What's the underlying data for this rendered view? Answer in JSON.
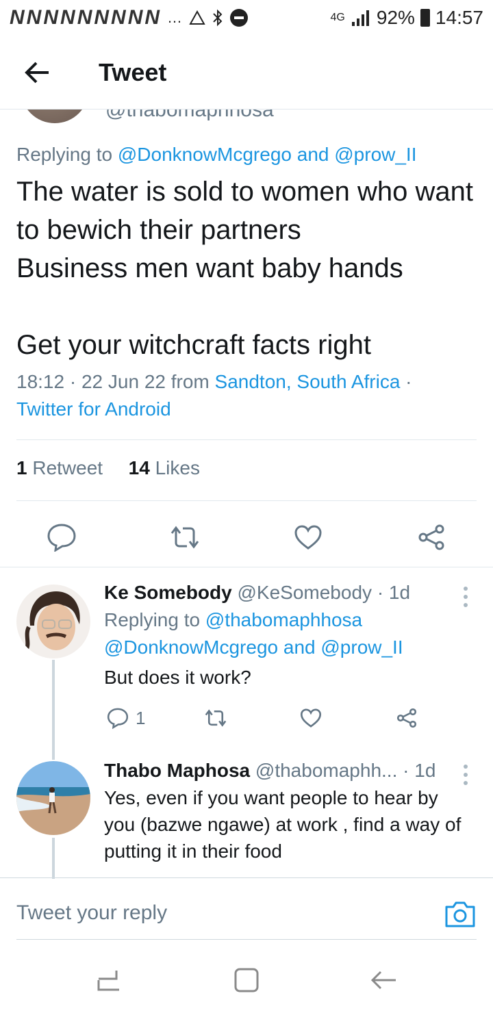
{
  "status_bar": {
    "notification_icons": [
      "N",
      "N",
      "N",
      "N",
      "N",
      "N",
      "N",
      "N",
      "N"
    ],
    "more": "…",
    "network": "4G",
    "battery": "92%",
    "time": "14:57"
  },
  "header": {
    "title": "Tweet"
  },
  "main_tweet": {
    "handle_partial": "@thabomaphhosa",
    "replying_prefix": "Replying to",
    "replying_user1": "@DonknowMcgrego",
    "replying_and": "and",
    "replying_user2": "@prow_II",
    "text": "The water is sold to women who want to bewich their partners\nBusiness men want baby hands\n\nGet your witchcraft facts right",
    "time": "18:12",
    "date": "22 Jun 22",
    "from": "from",
    "location": "Sandton, South Africa",
    "client": "Twitter for Android",
    "retweets_count": "1",
    "retweets_label": "Retweet",
    "likes_count": "14",
    "likes_label": "Likes"
  },
  "replies": [
    {
      "name": "Ke Somebody",
      "handle": "@KeSomebody",
      "age": "1d",
      "replying_prefix": "Replying to",
      "replying_user1": "@thabomaphhosa",
      "replying_user2": "@DonknowMcgrego",
      "replying_and": "and",
      "replying_user3": "@prow_II",
      "text": "But does it work?",
      "reply_count": "1"
    },
    {
      "name": "Thabo Maphosa",
      "handle": "@thabomaphh...",
      "age": "1d",
      "text": "Yes, even if you want people to hear by you (bazwe ngawe) at work , find a way of putting it in their food"
    }
  ],
  "compose": {
    "placeholder": "Tweet your reply"
  },
  "colors": {
    "accent": "#1b95e0",
    "muted": "#657786",
    "divider": "#e1e8ed"
  }
}
